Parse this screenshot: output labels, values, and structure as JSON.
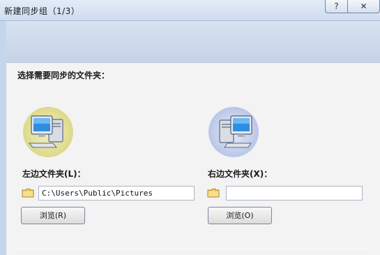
{
  "window": {
    "title": "新建同步组（1/3）",
    "help_glyph": "?",
    "close_glyph": "✕"
  },
  "page": {
    "instruction": "选择需要同步的文件夹："
  },
  "left": {
    "label": "左边文件夹(L)：",
    "path_value": "C:\\Users\\Public\\Pictures",
    "browse_label": "浏览(R)"
  },
  "right": {
    "label": "右边文件夹(X)：",
    "path_value": "",
    "browse_label": "浏览(O)"
  },
  "icons": {
    "computer": "computer-icon",
    "folder": "folder-icon"
  },
  "colors": {
    "left_icon_glow": "#e8e59a",
    "right_icon_glow": "#c9d4ee",
    "banner": "#cfdaea"
  }
}
